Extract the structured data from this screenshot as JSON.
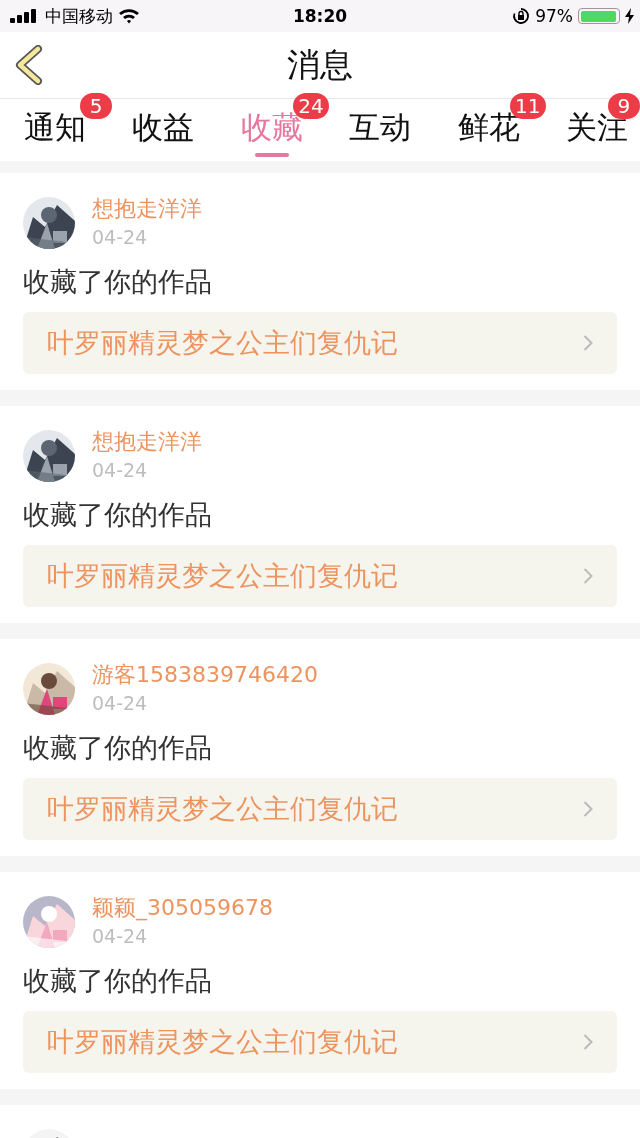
{
  "status_bar": {
    "carrier": "中国移动",
    "time": "18:20",
    "battery_text": "97%",
    "battery": {
      "level": 0.97,
      "charging": true
    }
  },
  "header": {
    "title": "消息"
  },
  "tabs": [
    {
      "label": "通知",
      "selected": false,
      "badge": "5"
    },
    {
      "label": "收益",
      "selected": false
    },
    {
      "label": "收藏",
      "selected": true,
      "badge": "24"
    },
    {
      "label": "互动",
      "selected": false
    },
    {
      "label": "鲜花",
      "selected": false,
      "badge": "11"
    },
    {
      "label": "关注",
      "selected": false,
      "badge": "9"
    }
  ],
  "messages": [
    {
      "avatar": {
        "kind": "picture"
      },
      "user": "想抱走洋洋",
      "date": "04-24",
      "text": "收藏了你的作品",
      "work": "叶罗丽精灵梦之公主们复仇记"
    },
    {
      "avatar": {
        "kind": "picture"
      },
      "user": "想抱走洋洋",
      "date": "04-24",
      "text": "收藏了你的作品",
      "work": "叶罗丽精灵梦之公主们复仇记"
    },
    {
      "avatar": {
        "kind": "picture"
      },
      "user": "游客1583839746420",
      "date": "04-24",
      "text": "收藏了你的作品",
      "work": "叶罗丽精灵梦之公主们复仇记"
    },
    {
      "avatar": {
        "kind": "picture"
      },
      "user": "颖颖_305059678",
      "date": "04-24",
      "text": "收藏了你的作品",
      "work": "叶罗丽精灵梦之公主们复仇记"
    },
    {
      "avatar": {
        "kind": "picture"
      }
    }
  ]
}
